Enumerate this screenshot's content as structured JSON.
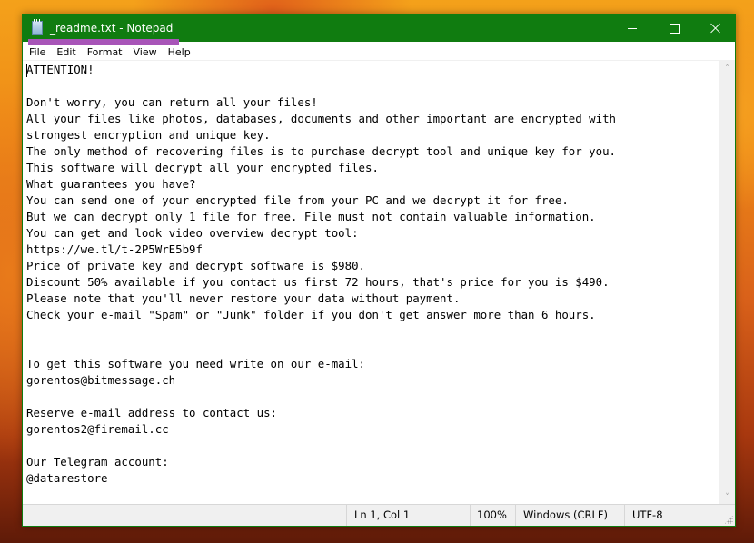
{
  "window": {
    "title": "_readme.txt - Notepad",
    "app_icon": "notepad-icon",
    "controls": {
      "minimize": "minimize-icon",
      "maximize": "maximize-icon",
      "close": "close-icon"
    },
    "accent_color": "#107c10"
  },
  "menu": {
    "items": [
      "File",
      "Edit",
      "Format",
      "View",
      "Help"
    ]
  },
  "editor": {
    "lines": [
      "ATTENTION!",
      "",
      "Don't worry, you can return all your files!",
      "All your files like photos, databases, documents and other important are encrypted with",
      "strongest encryption and unique key.",
      "The only method of recovering files is to purchase decrypt tool and unique key for you.",
      "This software will decrypt all your encrypted files.",
      "What guarantees you have?",
      "You can send one of your encrypted file from your PC and we decrypt it for free.",
      "But we can decrypt only 1 file for free. File must not contain valuable information.",
      "You can get and look video overview decrypt tool:",
      "https://we.tl/t-2P5WrE5b9f",
      "Price of private key and decrypt software is $980.",
      "Discount 50% available if you contact us first 72 hours, that's price for you is $490.",
      "Please note that you'll never restore your data without payment.",
      "Check your e-mail \"Spam\" or \"Junk\" folder if you don't get answer more than 6 hours.",
      "",
      "",
      "To get this software you need write on our e-mail:",
      "gorentos@bitmessage.ch",
      "",
      "Reserve e-mail address to contact us:",
      "gorentos2@firemail.cc",
      "",
      "Our Telegram account:",
      "@datarestore"
    ]
  },
  "scrollbar": {
    "up_arrow": "^",
    "down_arrow": "v"
  },
  "status": {
    "position": "Ln 1, Col 1",
    "zoom": "100%",
    "line_ending": "Windows (CRLF)",
    "encoding": "UTF-8"
  }
}
